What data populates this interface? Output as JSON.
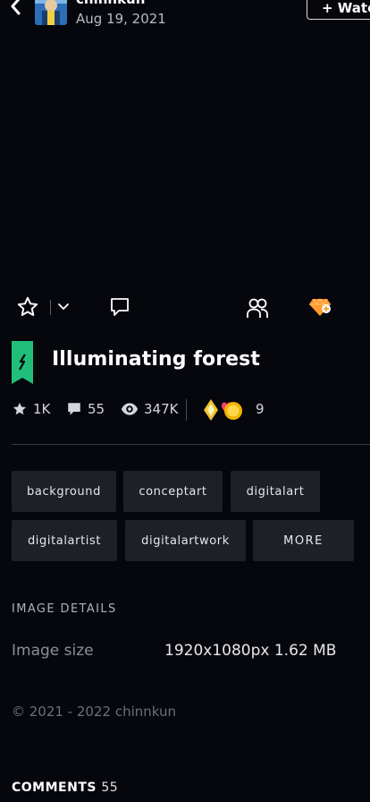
{
  "header": {
    "author": "chinnkun",
    "date": "Aug 19, 2021",
    "watch_label": "+ Watch"
  },
  "actions": {
    "icons": [
      "star-icon",
      "chevron-down-icon",
      "comment-icon",
      "group-icon",
      "gem-icon"
    ]
  },
  "deviation": {
    "title": "Illuminating forest"
  },
  "stats": {
    "favourites": "1K",
    "comments": "55",
    "views": "347K",
    "awards": "9"
  },
  "tags": [
    "background",
    "conceptart",
    "digitalart",
    "digitalartist",
    "digitalartwork"
  ],
  "more_label": "MORE",
  "details": {
    "heading": "IMAGE DETAILS",
    "size_label": "Image size",
    "size_value": "1920x1080px 1.62 MB"
  },
  "copyright": "© 2021 - 2022 chinnkun",
  "comments_section": {
    "label": "COMMENTS",
    "count": "55"
  },
  "colors": {
    "background": "#06070d",
    "tag_bg": "#1d2027",
    "badge_green": "#1fbf7a",
    "gem_orange": "#ff9a2e"
  }
}
